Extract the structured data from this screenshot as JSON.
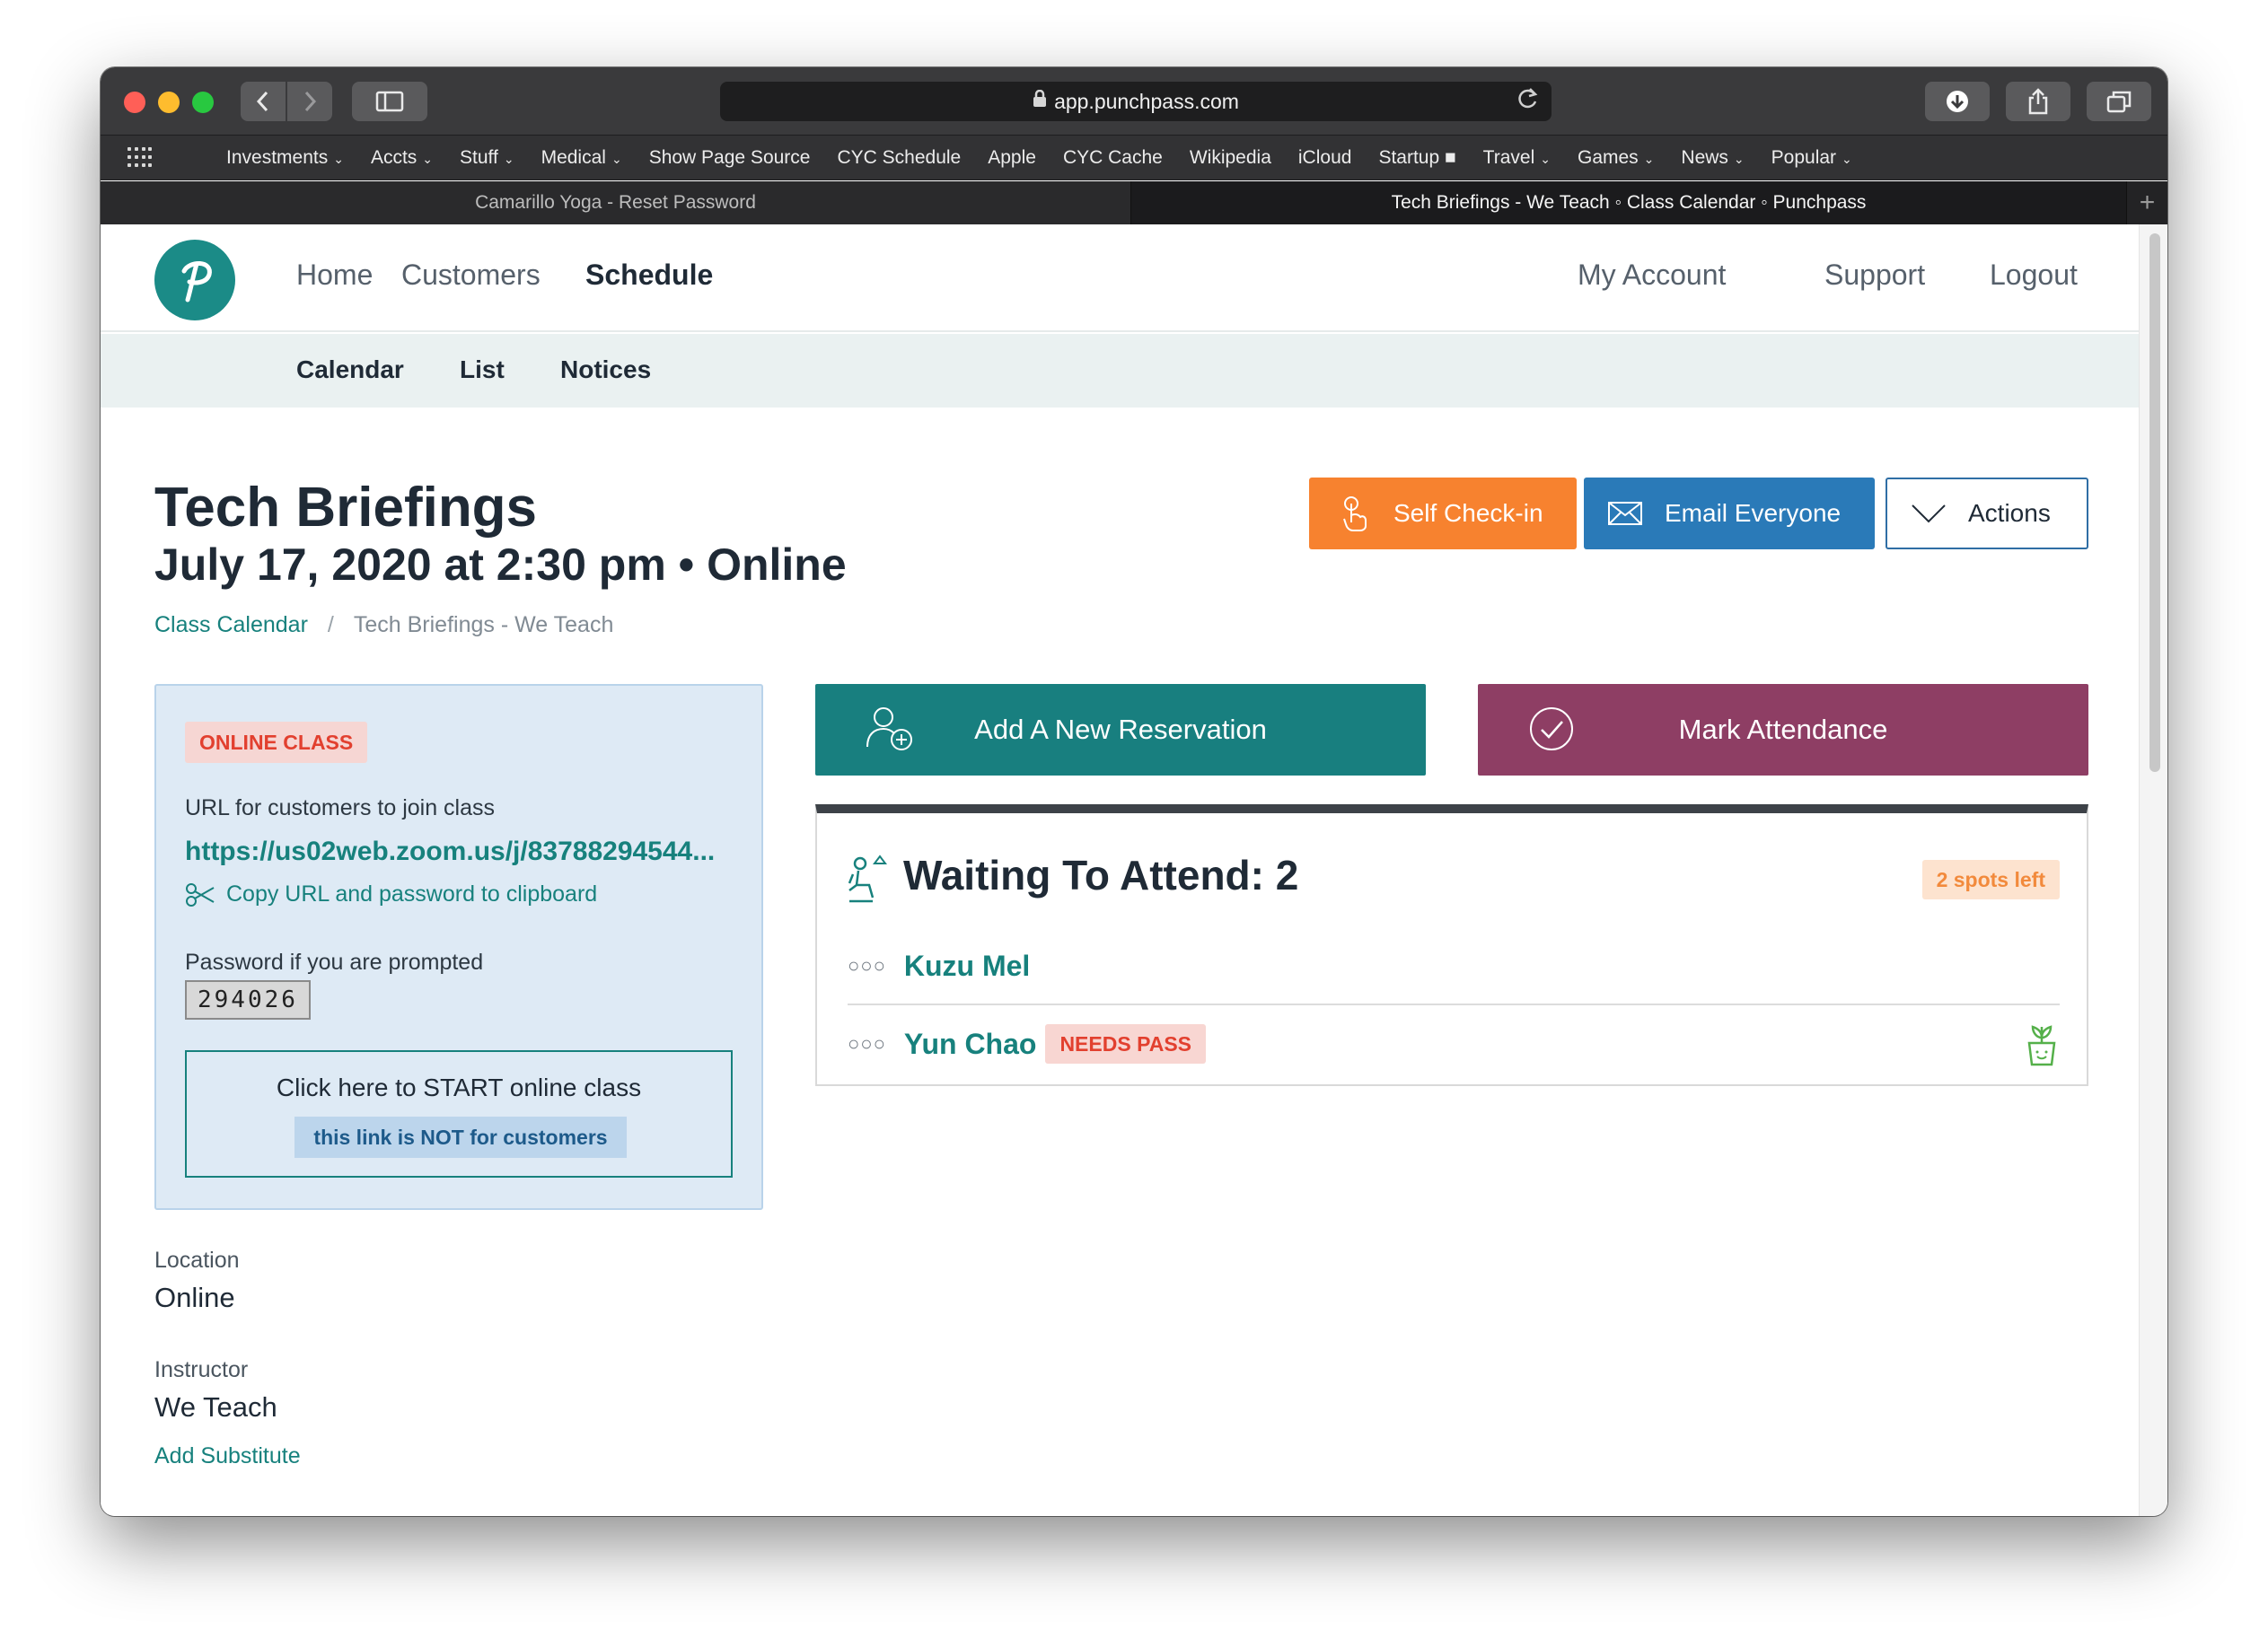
{
  "browser": {
    "url": "app.punchpass.com",
    "bookmarks": [
      {
        "label": "Investments",
        "caret": true
      },
      {
        "label": "Accts",
        "caret": true
      },
      {
        "label": "Stuff",
        "caret": true
      },
      {
        "label": "Medical",
        "caret": true
      },
      {
        "label": "Show Page Source",
        "caret": false
      },
      {
        "label": "CYC Schedule",
        "caret": false
      },
      {
        "label": "Apple",
        "caret": false
      },
      {
        "label": "CYC Cache",
        "caret": false
      },
      {
        "label": "Wikipedia",
        "caret": false
      },
      {
        "label": "iCloud",
        "caret": false
      },
      {
        "label": "Startup ■",
        "caret": false
      },
      {
        "label": "Travel",
        "caret": true
      },
      {
        "label": "Games",
        "caret": true
      },
      {
        "label": "News",
        "caret": true
      },
      {
        "label": "Popular",
        "caret": true
      }
    ],
    "tabs": {
      "inactive": "Camarillo Yoga - Reset Password",
      "active": "Tech Briefings - We Teach ◦ Class Calendar ◦ Punchpass"
    }
  },
  "nav": {
    "home": "Home",
    "customers": "Customers",
    "schedule": "Schedule",
    "my_account": "My Account",
    "support": "Support",
    "logout": "Logout"
  },
  "subnav": {
    "calendar": "Calendar",
    "list": "List",
    "notices": "Notices"
  },
  "header": {
    "title": "Tech Briefings",
    "subtitle": "July 17, 2020 at 2:30 pm • Online",
    "breadcrumb_link": "Class Calendar",
    "breadcrumb_sep": "/",
    "breadcrumb_current": "Tech Briefings - We Teach"
  },
  "actions": {
    "self_checkin": "Self Check-in",
    "email_everyone": "Email Everyone",
    "actions": "Actions"
  },
  "online_class": {
    "badge": "ONLINE CLASS",
    "url_label": "URL for customers to join class",
    "url": "https://us02web.zoom.us/j/83788294544...",
    "copy_label": "Copy URL and password to clipboard",
    "password_label": "Password if you are prompted",
    "password": "294026",
    "start_label": "Click here to START online class",
    "start_note": "this link is NOT for customers"
  },
  "details": {
    "location_label": "Location",
    "location": "Online",
    "instructor_label": "Instructor",
    "instructor": "We Teach",
    "add_substitute": "Add Substitute"
  },
  "reservations": {
    "add_label": "Add A New Reservation",
    "mark_label": "Mark Attendance",
    "waiting_title": "Waiting To Attend: 2",
    "spots_left": "2 spots left",
    "attendees": [
      {
        "name": "Kuzu Mel",
        "badge": ""
      },
      {
        "name": "Yun Chao",
        "badge": "NEEDS PASS"
      }
    ]
  },
  "colors": {
    "teal": "#187f7f",
    "orange": "#f7822f",
    "blue": "#2a7ab8",
    "plum": "#8e3e64"
  }
}
